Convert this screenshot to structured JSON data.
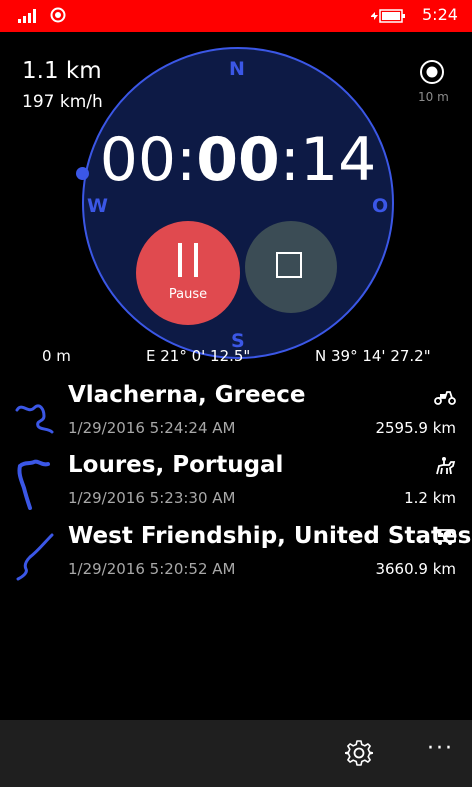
{
  "status": {
    "time": "5:24"
  },
  "tracker": {
    "distance": "1.1 km",
    "speed": "197 km/h",
    "gps_accuracy": "10 m",
    "timer": {
      "hours": "00:",
      "minutes": "00",
      "seconds": ":14"
    },
    "compass": {
      "north": "N",
      "west": "W",
      "east": "O",
      "south": "S"
    },
    "pause_label": "Pause",
    "altitude": "0 m",
    "longitude": "E 21° 0' 12.5\"",
    "latitude": "N 39° 14' 27.2\""
  },
  "history": [
    {
      "place": "Vlacherna, Greece",
      "timestamp": "1/29/2016 5:24:24 AM",
      "distance": "2595.9 km",
      "vehicle_icon": "scooter-icon"
    },
    {
      "place": "Loures, Portugal",
      "timestamp": "1/29/2016 5:23:30 AM",
      "distance": "1.2 km",
      "vehicle_icon": "horse-rider-icon"
    },
    {
      "place": "West Friendship, United States",
      "timestamp": "1/29/2016 5:20:52 AM",
      "distance": "3660.9 km",
      "vehicle_icon": "bus-icon"
    }
  ],
  "appbar": {
    "more": "···"
  },
  "colors": {
    "status_bar": "#ff0000",
    "accent": "#3b57e6",
    "pause": "#e04a4f",
    "stop": "#3b4c55"
  }
}
